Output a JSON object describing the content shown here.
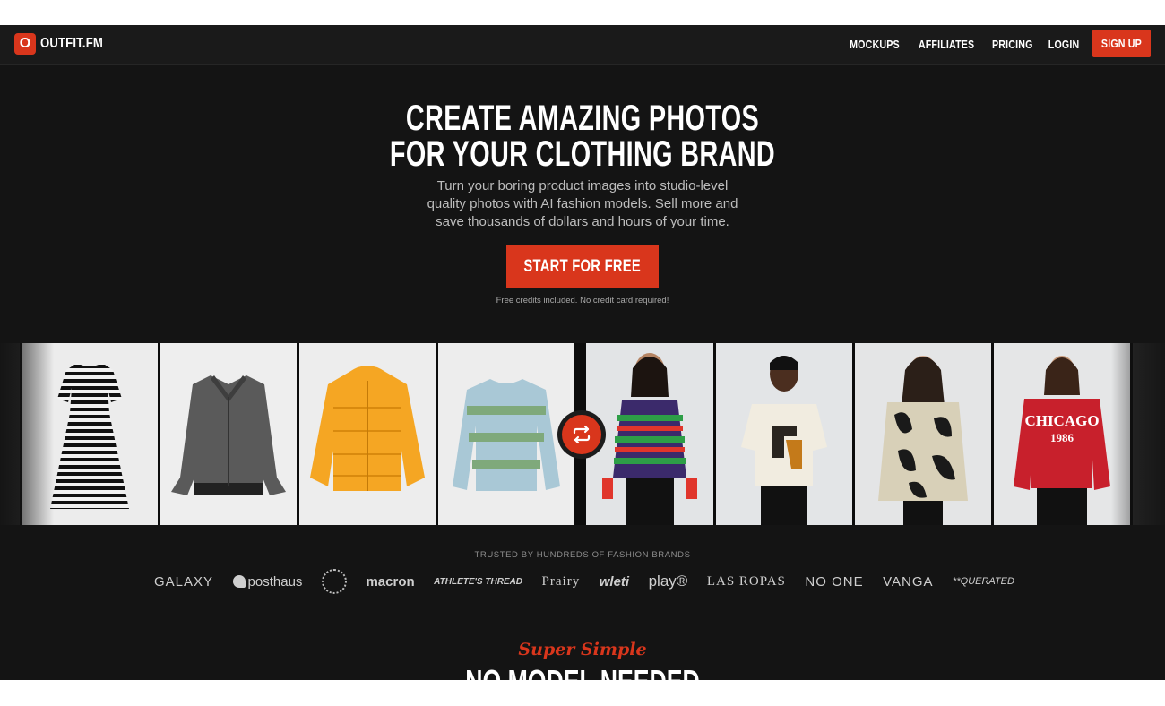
{
  "brand": {
    "mark": "O",
    "name": "OUTFIT.FM"
  },
  "nav": {
    "links": [
      "MOCKUPS",
      "AFFILIATES",
      "PRICING",
      "LOGIN"
    ],
    "signup": "SIGN UP"
  },
  "hero": {
    "headline_line1": "CREATE AMAZING PHOTOS",
    "headline_line2": "FOR YOUR CLOTHING BRAND",
    "subtext": "Turn your boring product images into studio-level quality photos with AI fashion models. Sell more and save thousands of dollars and hours of your time.",
    "cta": "START FOR FREE",
    "cta_note": "Free credits included. No credit card required!"
  },
  "strip": {
    "left_products": [
      "striped-dress",
      "grey-tweed-jacket",
      "yellow-puffer-jacket",
      "green-blue-sweater"
    ],
    "right_models": [
      "model-striped-sweater",
      "model-graphic-tee",
      "model-patterned-fleece",
      "model-chicago-hoodie"
    ],
    "hoodie_text_1": "CHICAGO",
    "hoodie_text_2": "1986",
    "swap_icon": "swap-arrows-icon"
  },
  "trusted": {
    "label": "TRUSTED BY HUNDREDS OF FASHION BRANDS",
    "brands": [
      "GALAXY",
      "posthaus",
      "macron",
      "ATHLETE'S THREAD",
      "Prairy",
      "wleti",
      "play®",
      "LAS ROPAS",
      "NO ONE",
      "VANGA",
      "**QUERATED"
    ]
  },
  "section": {
    "script": "Super Simple",
    "title": "NO MODEL NEEDED"
  },
  "colors": {
    "accent": "#d9361c",
    "background": "#141414"
  }
}
